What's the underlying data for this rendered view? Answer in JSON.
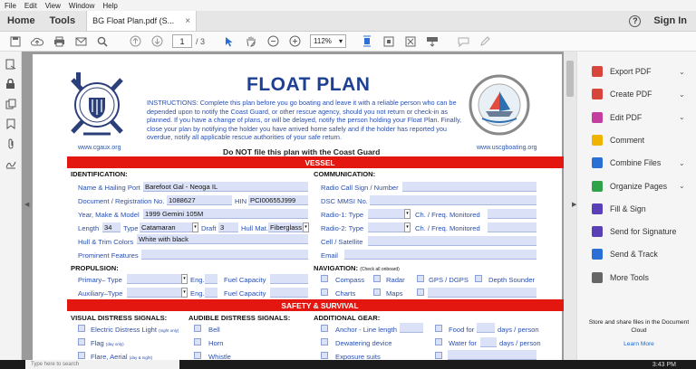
{
  "menu": [
    "File",
    "Edit",
    "View",
    "Window",
    "Help"
  ],
  "tabs": {
    "home": "Home",
    "tools": "Tools",
    "document": "BG Float Plan.pdf (S...",
    "close": "×"
  },
  "header": {
    "help": "?",
    "signin": "Sign In"
  },
  "toolbar": {
    "page_current": "1",
    "page_total": "/ 3",
    "zoom": "112%",
    "zoom_arrow": "▾"
  },
  "form": {
    "title": "FLOAT PLAN",
    "instructions": "INSTRUCTIONS: Complete this plan before you go boating and leave it with a reliable person who can be depended upon to notify the Coast Guard, or other rescue agency, should you not return or check-in as planned.  If you have a change of plans, or will be delayed, notify the person holding your Float Plan.  Finally, close your plan by notifying the holder you have arrived home safely and if the holder has reported you overdue, notify all applicable rescue authorities of your safe return.",
    "do_not_file": "Do NOT file this plan with the Coast Guard",
    "url_left": "www.cgaux.org",
    "url_right": "www.uscgboating.org",
    "vessel_header": "VESSEL",
    "safety_header": "SAFETY & SURVIVAL",
    "identification": "IDENTIFICATION:",
    "communication": "COMMUNICATION:",
    "propulsion": "PROPULSION:",
    "navigation": "NAVIGATION:",
    "navigation_note": "(Check all onboard)",
    "visual_signals": "VISUAL DISTRESS SIGNALS:",
    "audible_signals": "AUDIBLE DISTRESS SIGNALS:",
    "additional_gear": "ADDITIONAL GEAR:",
    "labels": {
      "name_port": "Name & Hailing Port",
      "doc_reg": "Document / Registration No.",
      "hin": "HIN",
      "year_make": "Year, Make & Model",
      "length": "Length",
      "type": "Type",
      "draft": "Draft",
      "hull_mat": "Hull Mat.",
      "hull_trim": "Hull & Trim Colors",
      "features": "Prominent Features",
      "radio_call": "Radio Call Sign / Number",
      "dsc_mmsi": "DSC MMSI No.",
      "radio1": "Radio-1: Type",
      "radio2": "Radio-2: Type",
      "freq": "Ch. / Freq. Monitored",
      "cell": "Cell / Satellite",
      "email": "Email",
      "primary": "Primary– Type",
      "auxiliary": "Auxiliary–Type",
      "eng": "Eng.",
      "fuel": "Fuel Capacity",
      "compass": "Compass",
      "radar": "Radar",
      "gps": "GPS / DGPS",
      "depth": "Depth Sounder",
      "charts": "Charts",
      "maps": "Maps",
      "edl": "Electric Distress Light",
      "edl_note": "(night only)",
      "flag": "Flag",
      "flag_note": "(day only)",
      "flare": "Flare, Aerial",
      "flare_note": "(day & night)",
      "bell": "Bell",
      "horn": "Horn",
      "whistle": "Whistle",
      "anchor": "Anchor - Line length",
      "dewatering": "Dewatering device",
      "exposure": "Exposure suits",
      "food_for": "Food for",
      "water_for": "Water for",
      "days_person": "days / person"
    },
    "values": {
      "name_port": "Barefoot Gal - Neoga IL",
      "doc_reg": "1088627",
      "hin": "PCI00655J999",
      "year_make": "1999 Gemini 105M",
      "length": "34",
      "type": "Catamaran",
      "draft": "3",
      "hull_mat": "Fiberglass",
      "hull_trim": "White with black"
    }
  },
  "tools": [
    {
      "label": "Export PDF",
      "color": "#d8453a",
      "chevron": "⌄"
    },
    {
      "label": "Create PDF",
      "color": "#d8453a",
      "chevron": "⌄"
    },
    {
      "label": "Edit PDF",
      "color": "#c43ea0",
      "chevron": "⌄"
    },
    {
      "label": "Comment",
      "color": "#f0b400",
      "chevron": ""
    },
    {
      "label": "Combine Files",
      "color": "#2a6fd6",
      "chevron": "⌄"
    },
    {
      "label": "Organize Pages",
      "color": "#2fa24a",
      "chevron": "⌄"
    },
    {
      "label": "Fill & Sign",
      "color": "#5a3fb6",
      "chevron": ""
    },
    {
      "label": "Send for Signature",
      "color": "#5a3fb6",
      "chevron": ""
    },
    {
      "label": "Send & Track",
      "color": "#2a6fd6",
      "chevron": ""
    },
    {
      "label": "More Tools",
      "color": "#666666",
      "chevron": ""
    }
  ],
  "promo": {
    "text": "Store and share files in the Document Cloud",
    "learn": "Learn More"
  },
  "taskbar": {
    "search": "Type here to search",
    "time": "3:43 PM"
  }
}
